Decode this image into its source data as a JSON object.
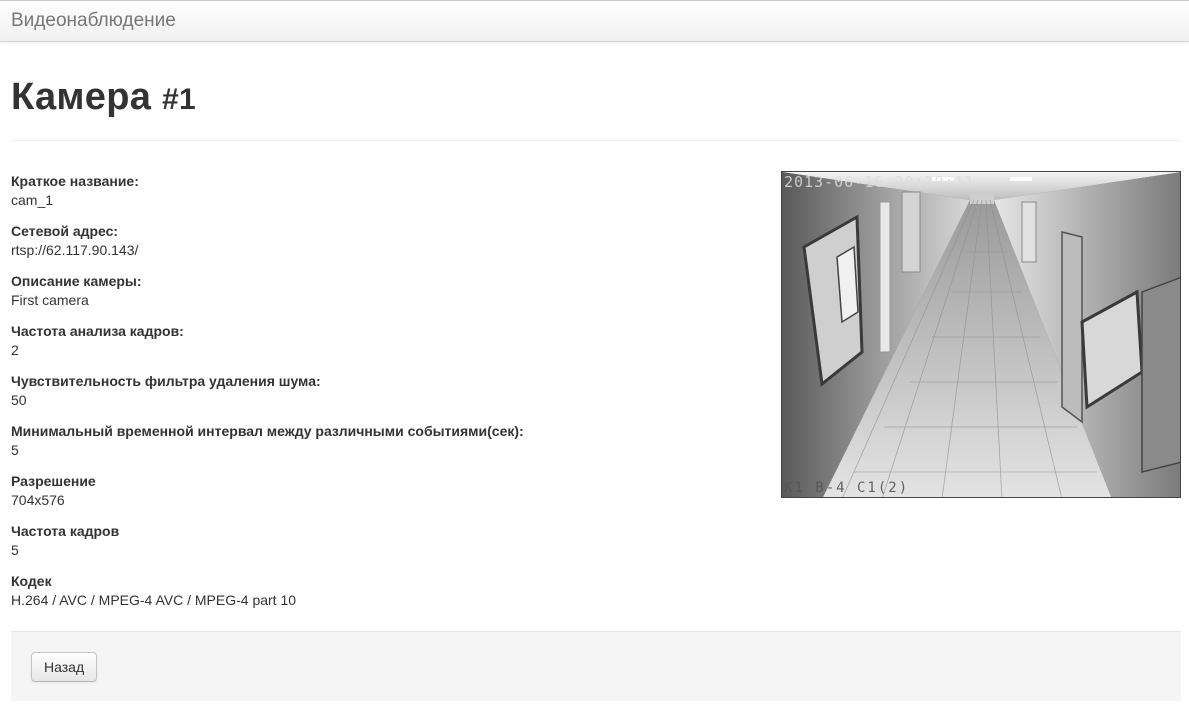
{
  "navbar": {
    "brand": "Видеонаблюдение"
  },
  "page": {
    "title": "Камера",
    "number": "#1"
  },
  "fields": [
    {
      "label": "Краткое название:",
      "value": "cam_1"
    },
    {
      "label": "Сетевой адрес:",
      "value": "rtsp://62.117.90.143/"
    },
    {
      "label": "Описание камеры:",
      "value": "First camera"
    },
    {
      "label": "Частота анализа кадров:",
      "value": "2"
    },
    {
      "label": "Чувствительность фильтра удаления шума:",
      "value": "50"
    },
    {
      "label": "Минимальный временной интервал между различными событиями(сек):",
      "value": "5"
    },
    {
      "label": "Разрешение",
      "value": "704x576"
    },
    {
      "label": "Частота кадров",
      "value": "5"
    },
    {
      "label": "Кодек",
      "value": "H.264 / AVC / MPEG-4 AVC / MPEG-4 part 10"
    }
  ],
  "camera": {
    "timestamp_overlay": "2013-06-16 20:29:11",
    "channel_overlay": "K1 B-4 C1(2)"
  },
  "actions": {
    "back_label": "Назад"
  }
}
